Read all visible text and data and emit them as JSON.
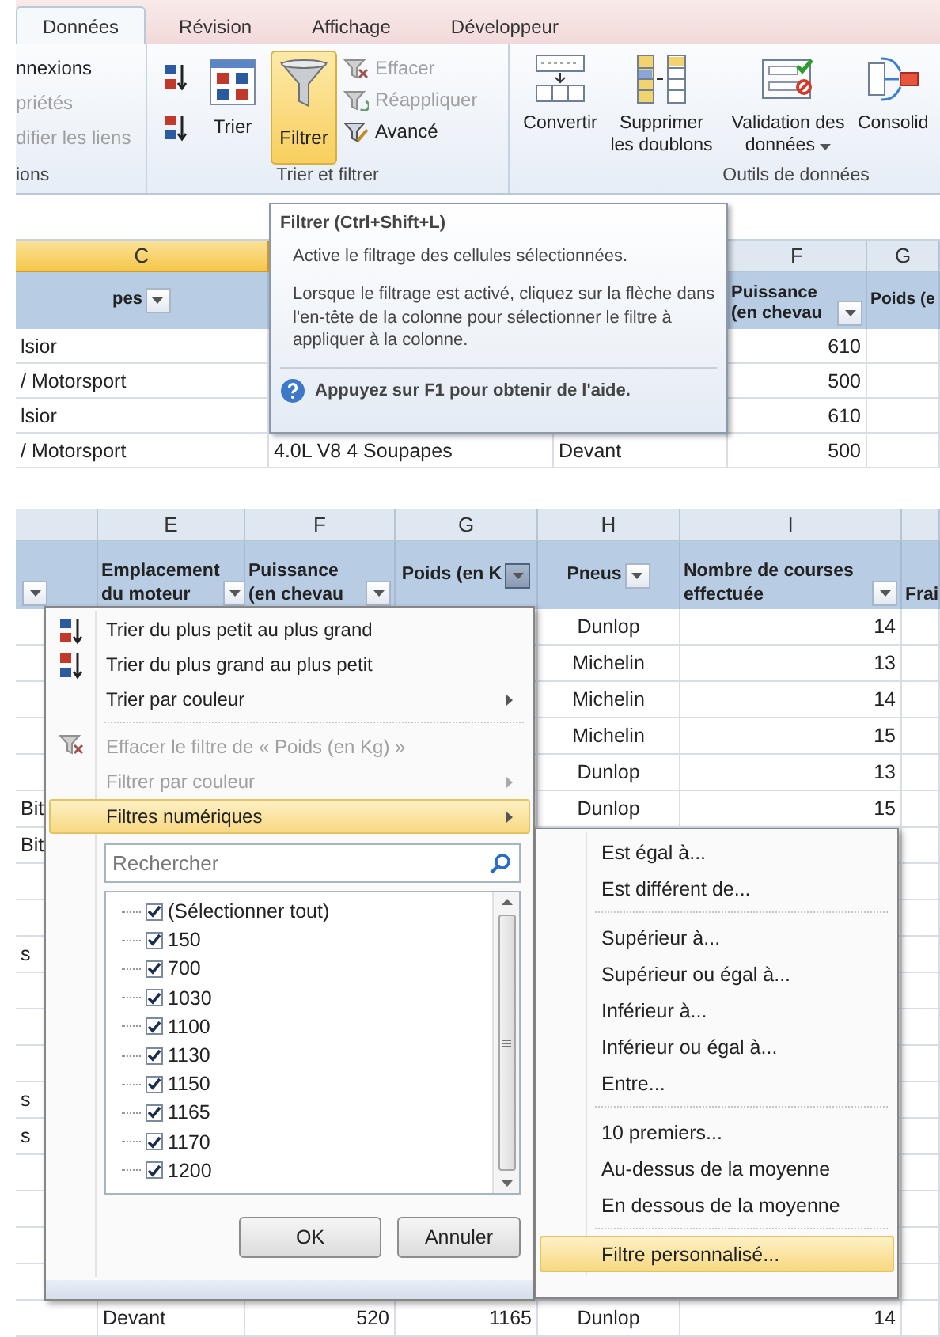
{
  "ribbon": {
    "tabs": [
      {
        "label": "Données",
        "selected": true
      },
      {
        "label": "Révision",
        "selected": false
      },
      {
        "label": "Affichage",
        "selected": false
      },
      {
        "label": "Développeur",
        "selected": false
      }
    ],
    "groups": [
      {
        "kind": "connections",
        "label": "ions",
        "items": [
          {
            "label": "nnexions",
            "disabled": false
          },
          {
            "label": "priétés",
            "disabled": true
          },
          {
            "label": "difier les liens",
            "disabled": true
          }
        ]
      },
      {
        "kind": "sort_filter",
        "label": "Trier et filtrer",
        "sort_label": "Trier",
        "filter": {
          "label": "Filtrer",
          "selected": true
        },
        "items": [
          {
            "label": "Effacer",
            "disabled": true
          },
          {
            "label": "Réappliquer",
            "disabled": true
          },
          {
            "label": "Avancé",
            "disabled": false
          }
        ]
      },
      {
        "kind": "data_tools",
        "label": "Outils de données",
        "buttons": [
          {
            "label": "Convertir",
            "dropdown": false
          },
          {
            "label": "Supprimer les doublons",
            "dropdown": false
          },
          {
            "label": "Validation des données",
            "dropdown": true
          },
          {
            "label": "Consolid",
            "dropdown": false
          }
        ]
      }
    ]
  },
  "tooltip": {
    "title": "Filtrer (Ctrl+Shift+L)",
    "paragraphs": [
      "Active le filtrage des cellules sélectionnées.",
      "Lorsque le filtrage est activé, cliquez sur la flèche dans l'en-tête de la colonne pour sélectionner le filtre à appliquer à la colonne."
    ],
    "help": "Appuyez sur F1 pour obtenir de l'aide."
  },
  "top_sheet": {
    "columns": [
      {
        "letter": "C",
        "selected": true,
        "header": "pes",
        "filter_button": true
      },
      {},
      {},
      {
        "letter": "F",
        "selected": false,
        "header": "Puissance (en chevau",
        "filter_button": true
      },
      {
        "letter": "G",
        "selected": false,
        "header": "Poids (e"
      }
    ],
    "rows": [
      {
        "column_c": "lsior",
        "column_f": "610"
      },
      {
        "column_c": "/ Motorsport",
        "column_f": "500"
      },
      {
        "column_c": "lsior",
        "column_f": "610"
      },
      {
        "column_c": "/ Motorsport",
        "column_d": "4.0L V8 4 Soupapes",
        "column_e": "Devant",
        "column_f": "500"
      }
    ]
  },
  "bottom_sheet": {
    "columns": [
      {
        "filter_button": true,
        "pressed": false
      },
      {
        "letter": "E",
        "header": "Emplacement du moteur",
        "filter_button": true,
        "pressed": false
      },
      {
        "letter": "F",
        "header": "Puissance (en chevau",
        "filter_button": true,
        "pressed": false
      },
      {
        "letter": "G",
        "header": "Poids (en K",
        "filter_button": true,
        "pressed": true
      },
      {
        "letter": "H",
        "header": "Pneus",
        "filter_button": true,
        "pressed": false
      },
      {
        "letter": "I",
        "header": "Nombre de courses effectuée",
        "filter_button": true,
        "pressed": false
      },
      {
        "header": "Frai"
      }
    ],
    "rows": [
      {
        "column_h": "Dunlop",
        "column_i": "14"
      },
      {
        "column_h": "Michelin",
        "column_i": "13"
      },
      {
        "column_h": "Michelin",
        "column_i": "14"
      },
      {
        "column_h": "Michelin",
        "column_i": "15"
      },
      {
        "column_h": "Dunlop",
        "column_i": "13"
      },
      {
        "column_d": "Bit",
        "column_h": "Dunlop",
        "column_i": "15"
      },
      {
        "column_d": "Bit"
      },
      {},
      {},
      {
        "column_d": "s"
      },
      {},
      {},
      {},
      {
        "column_d": "s"
      },
      {
        "column_d": "s"
      },
      {},
      {},
      {},
      {},
      {
        "column_e": "Devant",
        "column_f": "520",
        "column_g": "1165",
        "column_h": "Dunlop",
        "column_i": "14"
      }
    ]
  },
  "filter_menu": {
    "items": [
      {
        "kind": "sort_asc",
        "label": "Trier du plus petit au plus grand",
        "disabled": false,
        "submenu": false,
        "selected": false
      },
      {
        "kind": "sort_desc",
        "label": "Trier du plus grand au plus petit",
        "disabled": false,
        "submenu": false,
        "selected": false
      },
      {
        "kind": "plain",
        "label": "Trier par couleur",
        "disabled": false,
        "submenu": true,
        "selected": false
      },
      {
        "kind": "separator"
      },
      {
        "kind": "clear_filter",
        "label": "Effacer le filtre de « Poids (en Kg) »",
        "disabled": true,
        "submenu": false,
        "selected": false
      },
      {
        "kind": "plain",
        "label": "Filtrer par couleur",
        "disabled": true,
        "submenu": true,
        "selected": false
      },
      {
        "kind": "plain",
        "label": "Filtres numériques",
        "disabled": false,
        "submenu": true,
        "selected": true
      }
    ],
    "search": {
      "placeholder": "Rechercher"
    },
    "values": [
      {
        "label": "(Sélectionner tout)",
        "checked": true
      },
      {
        "label": "150",
        "checked": true
      },
      {
        "label": "700",
        "checked": true
      },
      {
        "label": "1030",
        "checked": true
      },
      {
        "label": "1100",
        "checked": true
      },
      {
        "label": "1130",
        "checked": true
      },
      {
        "label": "1150",
        "checked": true
      },
      {
        "label": "1165",
        "checked": true
      },
      {
        "label": "1170",
        "checked": true
      },
      {
        "label": "1200",
        "checked": true
      }
    ],
    "buttons": [
      "OK",
      "Annuler"
    ]
  },
  "number_filters_menu": {
    "items": [
      {
        "kind": "item",
        "label": "Est égal à...",
        "selected": false
      },
      {
        "kind": "item",
        "label": "Est différent de...",
        "selected": false
      },
      {
        "kind": "separator"
      },
      {
        "kind": "item",
        "label": "Supérieur à...",
        "selected": false
      },
      {
        "kind": "item",
        "label": "Supérieur ou égal à...",
        "selected": false
      },
      {
        "kind": "item",
        "label": "Inférieur à...",
        "selected": false
      },
      {
        "kind": "item",
        "label": "Inférieur ou égal à...",
        "selected": false
      },
      {
        "kind": "item",
        "label": "Entre...",
        "selected": false
      },
      {
        "kind": "separator"
      },
      {
        "kind": "item",
        "label": "10 premiers...",
        "selected": false
      },
      {
        "kind": "item",
        "label": "Au-dessus de la moyenne",
        "selected": false
      },
      {
        "kind": "item",
        "label": "En dessous de la moyenne",
        "selected": false
      },
      {
        "kind": "separator"
      },
      {
        "kind": "item",
        "label": "Filtre personnalisé...",
        "selected": true
      }
    ]
  }
}
